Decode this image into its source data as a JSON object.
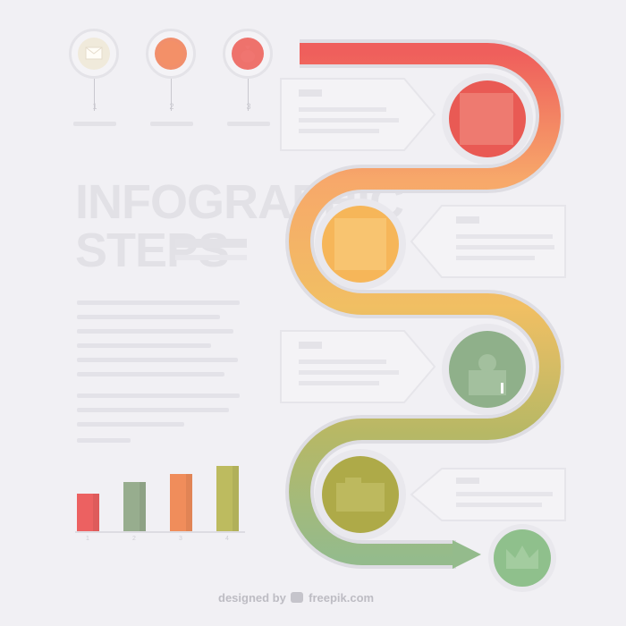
{
  "title": {
    "line1": "INFOGRAPHIC",
    "line2": "STEPS"
  },
  "legend": [
    {
      "number": "1",
      "color": "#efe7d6",
      "icon": "envelope-icon"
    },
    {
      "number": "2",
      "color": "#f07c53",
      "icon": "circle-icon"
    },
    {
      "number": "3",
      "color": "#ec5b54",
      "icon": "bag-icon"
    }
  ],
  "steps": [
    {
      "color": "#e95a54",
      "icon": "step-1-icon"
    },
    {
      "color": "#f6b659",
      "icon": "step-2-icon"
    },
    {
      "color": "#8fb08a",
      "icon": "step-3-icon"
    },
    {
      "color": "#aeaa48",
      "icon": "step-4-icon"
    },
    {
      "color": "#8fc08c",
      "icon": "crown-icon"
    }
  ],
  "chart_data": {
    "type": "bar",
    "categories": [
      "1",
      "2",
      "3",
      "4"
    ],
    "values": [
      45,
      58,
      68,
      78
    ],
    "ylim": [
      0,
      100
    ],
    "colors": [
      "#ec6161",
      "#97ad8e",
      "#f08d5b",
      "#bdbb5f"
    ],
    "grid": false
  },
  "footer": {
    "prefix": "designed by",
    "brand": "freepik.com"
  }
}
